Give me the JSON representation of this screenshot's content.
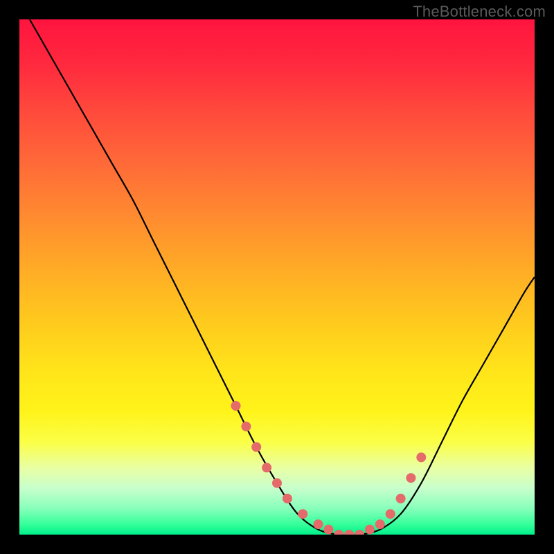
{
  "watermark": "TheBottleneck.com",
  "colors": {
    "background": "#000000",
    "gradient_top": "#ff143f",
    "gradient_bottom": "#00f08a",
    "curve": "#000000",
    "dots": "#e56a6a"
  },
  "chart_data": {
    "type": "line",
    "title": "",
    "xlabel": "",
    "ylabel": "",
    "xlim": [
      0,
      100
    ],
    "ylim": [
      0,
      100
    ],
    "series": [
      {
        "name": "curve",
        "x": [
          2,
          6,
          10,
          14,
          18,
          22,
          26,
          30,
          34,
          38,
          42,
          46,
          50,
          54,
          58,
          62,
          66,
          70,
          74,
          78,
          82,
          86,
          90,
          94,
          98,
          100
        ],
        "y": [
          100,
          93,
          86,
          79,
          72,
          65,
          57,
          49,
          41,
          33,
          25,
          17,
          10,
          4,
          1,
          0,
          0,
          1,
          4,
          10,
          18,
          26,
          33,
          40,
          47,
          50
        ]
      }
    ],
    "highlight_points": {
      "name": "dots",
      "x": [
        42,
        44,
        46,
        48,
        50,
        52,
        55,
        58,
        60,
        62,
        64,
        66,
        68,
        70,
        72,
        74,
        76,
        78
      ],
      "y": [
        25,
        21,
        17,
        13,
        10,
        7,
        4,
        2,
        1,
        0,
        0,
        0,
        1,
        2,
        4,
        7,
        11,
        15
      ]
    }
  }
}
